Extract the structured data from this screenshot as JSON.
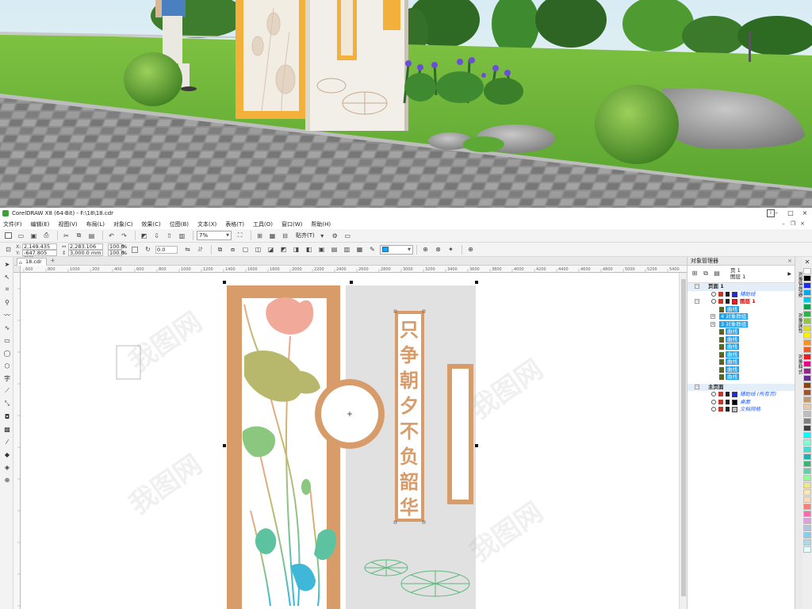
{
  "window": {
    "title": "CorelDRAW X8 (64-Bit) - F:\\18\\18.cdr",
    "controls": [
      "–",
      "□",
      "×"
    ]
  },
  "menu": {
    "items": [
      "文件(F)",
      "编辑(E)",
      "视图(V)",
      "布局(L)",
      "对象(C)",
      "效果(C)",
      "位图(B)",
      "文本(X)",
      "表格(T)",
      "工具(O)",
      "窗口(W)",
      "帮助(H)"
    ]
  },
  "toolbar": {
    "zoom": "7%",
    "snap_label": "贴齐(T)"
  },
  "property_bar": {
    "x_label": "X:",
    "x_value": "2,149.435 mm",
    "y_label": "Y:",
    "y_value": "-647.805 mm",
    "w_value": "2,283.106 mm",
    "h_value": "3,000.0 mm",
    "scale_x": "100.0",
    "scale_y": "100.0",
    "scale_unit": "%",
    "rotation": "0.0"
  },
  "document": {
    "tab_label": "18.cdr",
    "add_tab": "+"
  },
  "ruler": {
    "h_ticks": [
      "600",
      "800",
      "1000",
      "200",
      "400",
      "600",
      "800",
      "1000",
      "1200",
      "1400",
      "1600",
      "1800",
      "2000",
      "2200",
      "2400",
      "2600",
      "2800",
      "3000",
      "3200",
      "3400",
      "3600",
      "3800",
      "4000",
      "4200",
      "4400",
      "4600",
      "4800",
      "5000",
      "5200",
      "5400"
    ]
  },
  "artwork": {
    "calligraphy": [
      "只",
      "争",
      "朝",
      "夕",
      "不",
      "负",
      "韶",
      "华"
    ]
  },
  "object_manager": {
    "title": "对象管理器",
    "page_label": "页 1",
    "layer_label": "图层 1",
    "tree": [
      {
        "kind": "page",
        "label": "页面 1"
      },
      {
        "kind": "layer",
        "label": "辅助线",
        "style": "blue"
      },
      {
        "kind": "layer",
        "label": "图层 1",
        "style": "red"
      },
      {
        "kind": "item",
        "label": "曲线"
      },
      {
        "kind": "group",
        "label": "4 对象群组"
      },
      {
        "kind": "group",
        "label": "3 对象群组"
      },
      {
        "kind": "item",
        "label": "曲线"
      },
      {
        "kind": "item",
        "label": "曲线"
      },
      {
        "kind": "item",
        "label": "曲线"
      },
      {
        "kind": "item",
        "label": "曲线"
      },
      {
        "kind": "item",
        "label": "曲线"
      },
      {
        "kind": "item",
        "label": "曲线"
      },
      {
        "kind": "item",
        "label": "曲线"
      },
      {
        "kind": "page",
        "label": "主页面"
      },
      {
        "kind": "layer",
        "label": "辅助线 (所有页)",
        "style": "blue"
      },
      {
        "kind": "layer",
        "label": "桌面",
        "style": "blue"
      },
      {
        "kind": "layer",
        "label": "文档网格",
        "style": "blue"
      }
    ]
  },
  "docker_tabs": [
    "对象管理器",
    "对象属性",
    "对象样式"
  ],
  "palette": [
    "#ffffff",
    "#000000",
    "#1e2ce8",
    "#00a8ec",
    "#00c6e8",
    "#00a650",
    "#2cb34a",
    "#8dc63f",
    "#d7df23",
    "#fff200",
    "#f7941d",
    "#f15a24",
    "#ed1c24",
    "#ec008c",
    "#92278f",
    "#662d91",
    "#8b4513",
    "#a0522d",
    "#c49a6c",
    "#e6c9a8",
    "#bdbdbd",
    "#808080",
    "#404040",
    "#00ffff",
    "#7fffd4",
    "#40e0d0",
    "#20b2aa",
    "#3cb371",
    "#66cdaa",
    "#98fb98",
    "#f0e68c",
    "#ffe4b5",
    "#ffdab9",
    "#fa8072",
    "#ff69b4",
    "#dda0dd",
    "#b0c4de",
    "#87ceeb",
    "#add8e6",
    "#e0ffff"
  ],
  "watermark": "我图网",
  "colors": {
    "frame_brown": "#d89c6a",
    "selection_blue": "#1da1f2",
    "canvas_grey": "#e1e1e1"
  }
}
